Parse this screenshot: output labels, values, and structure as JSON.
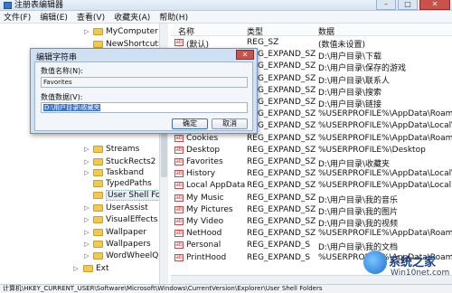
{
  "window": {
    "title": "注册表编辑器"
  },
  "menu": [
    "文件(F)",
    "编辑(E)",
    "查看(V)",
    "收藏夹(A)",
    "帮助(H)"
  ],
  "tree": {
    "items": [
      {
        "label": "MyComputer"
      },
      {
        "label": "NewShortcutHa"
      },
      {
        "label": "Streams"
      },
      {
        "label": "StuckRects2"
      },
      {
        "label": "Taskband"
      },
      {
        "label": "TypedPaths"
      },
      {
        "label": "User Shell Folde",
        "selected": true
      },
      {
        "label": "UserAssist"
      },
      {
        "label": "VisualEffects"
      },
      {
        "label": "Wallpaper"
      },
      {
        "label": "Wallpapers"
      },
      {
        "label": "WordWheelQue"
      },
      {
        "label": "Ext"
      }
    ]
  },
  "list": {
    "headers": {
      "name": "名称",
      "type": "类型",
      "data": "数据"
    },
    "rows": [
      {
        "name": "(默认)",
        "type": "REG_SZ",
        "data": "(数值未设置)"
      },
      {
        "name": "",
        "type": "REG_EXPAND_SZ",
        "data": "D:\\用户目录\\下载"
      },
      {
        "name": "",
        "type": "REG_EXPAND_SZ",
        "data": "D:\\用户目录\\保存的游戏"
      },
      {
        "name": "",
        "type": "REG_EXPAND_SZ",
        "data": "D:\\用户目录\\联系人"
      },
      {
        "name": "",
        "type": "REG_EXPAND_SZ",
        "data": "D:\\用户目录\\搜索"
      },
      {
        "name": "",
        "type": "REG_EXPAND_SZ",
        "data": "D:\\用户目录\\链接"
      },
      {
        "name": "",
        "type": "REG_EXPAND_SZ",
        "data": "%USERPROFILE%\\AppData\\Roam"
      },
      {
        "name": "",
        "type": "REG_EXPAND_SZ",
        "data": "%USERPROFILE%\\AppData\\Local\\"
      },
      {
        "name": "Cookies",
        "type": "REG_EXPAND_SZ",
        "data": "%USERPROFILE%\\AppData\\Roam"
      },
      {
        "name": "Desktop",
        "type": "REG_EXPAND_SZ",
        "data": "%USERPROFILE%\\Desktop"
      },
      {
        "name": "Favorites",
        "type": "REG_EXPAND_SZ",
        "data": "D:\\用户目录\\收藏夹"
      },
      {
        "name": "History",
        "type": "REG_EXPAND_SZ",
        "data": "%USERPROFILE%\\AppData\\Local\\"
      },
      {
        "name": "Local AppData",
        "type": "REG_EXPAND_SZ",
        "data": "%USERPROFILE%\\AppData\\Local"
      },
      {
        "name": "My Music",
        "type": "REG_EXPAND_SZ",
        "data": "D:\\用户目录\\我的音乐"
      },
      {
        "name": "My Pictures",
        "type": "REG_EXPAND_SZ",
        "data": "D:\\用户目录\\我的图片"
      },
      {
        "name": "My Video",
        "type": "REG_EXPAND_SZ",
        "data": "D:\\用户目录\\我的视频"
      },
      {
        "name": "NetHood",
        "type": "REG_EXPAND_SZ",
        "data": "%USERPROFILE%\\AppData\\Roam"
      },
      {
        "name": "Personal",
        "type": "REG_EXPAND_S",
        "data": "D:\\用户目录\\我的文档"
      },
      {
        "name": "PrintHood",
        "type": "REG_EXPAND_S",
        "data": "%USERPROFILE%\\AppData\\Roam"
      }
    ]
  },
  "dialog": {
    "title": "编辑字符串",
    "name_label": "数值名称(N):",
    "name_value": "Favorites",
    "data_label": "数值数据(V):",
    "data_value": "D:\\用户目录\\收藏夹",
    "ok_label": "确定",
    "cancel_label": "取消"
  },
  "statusbar": {
    "path": "计算机\\HKEY_CURRENT_USER\\Software\\Microsoft\\Windows\\CurrentVersion\\Explorer\\User Shell Folders"
  },
  "watermark": {
    "line1": "系统之家",
    "line2": "Win10net.com"
  }
}
